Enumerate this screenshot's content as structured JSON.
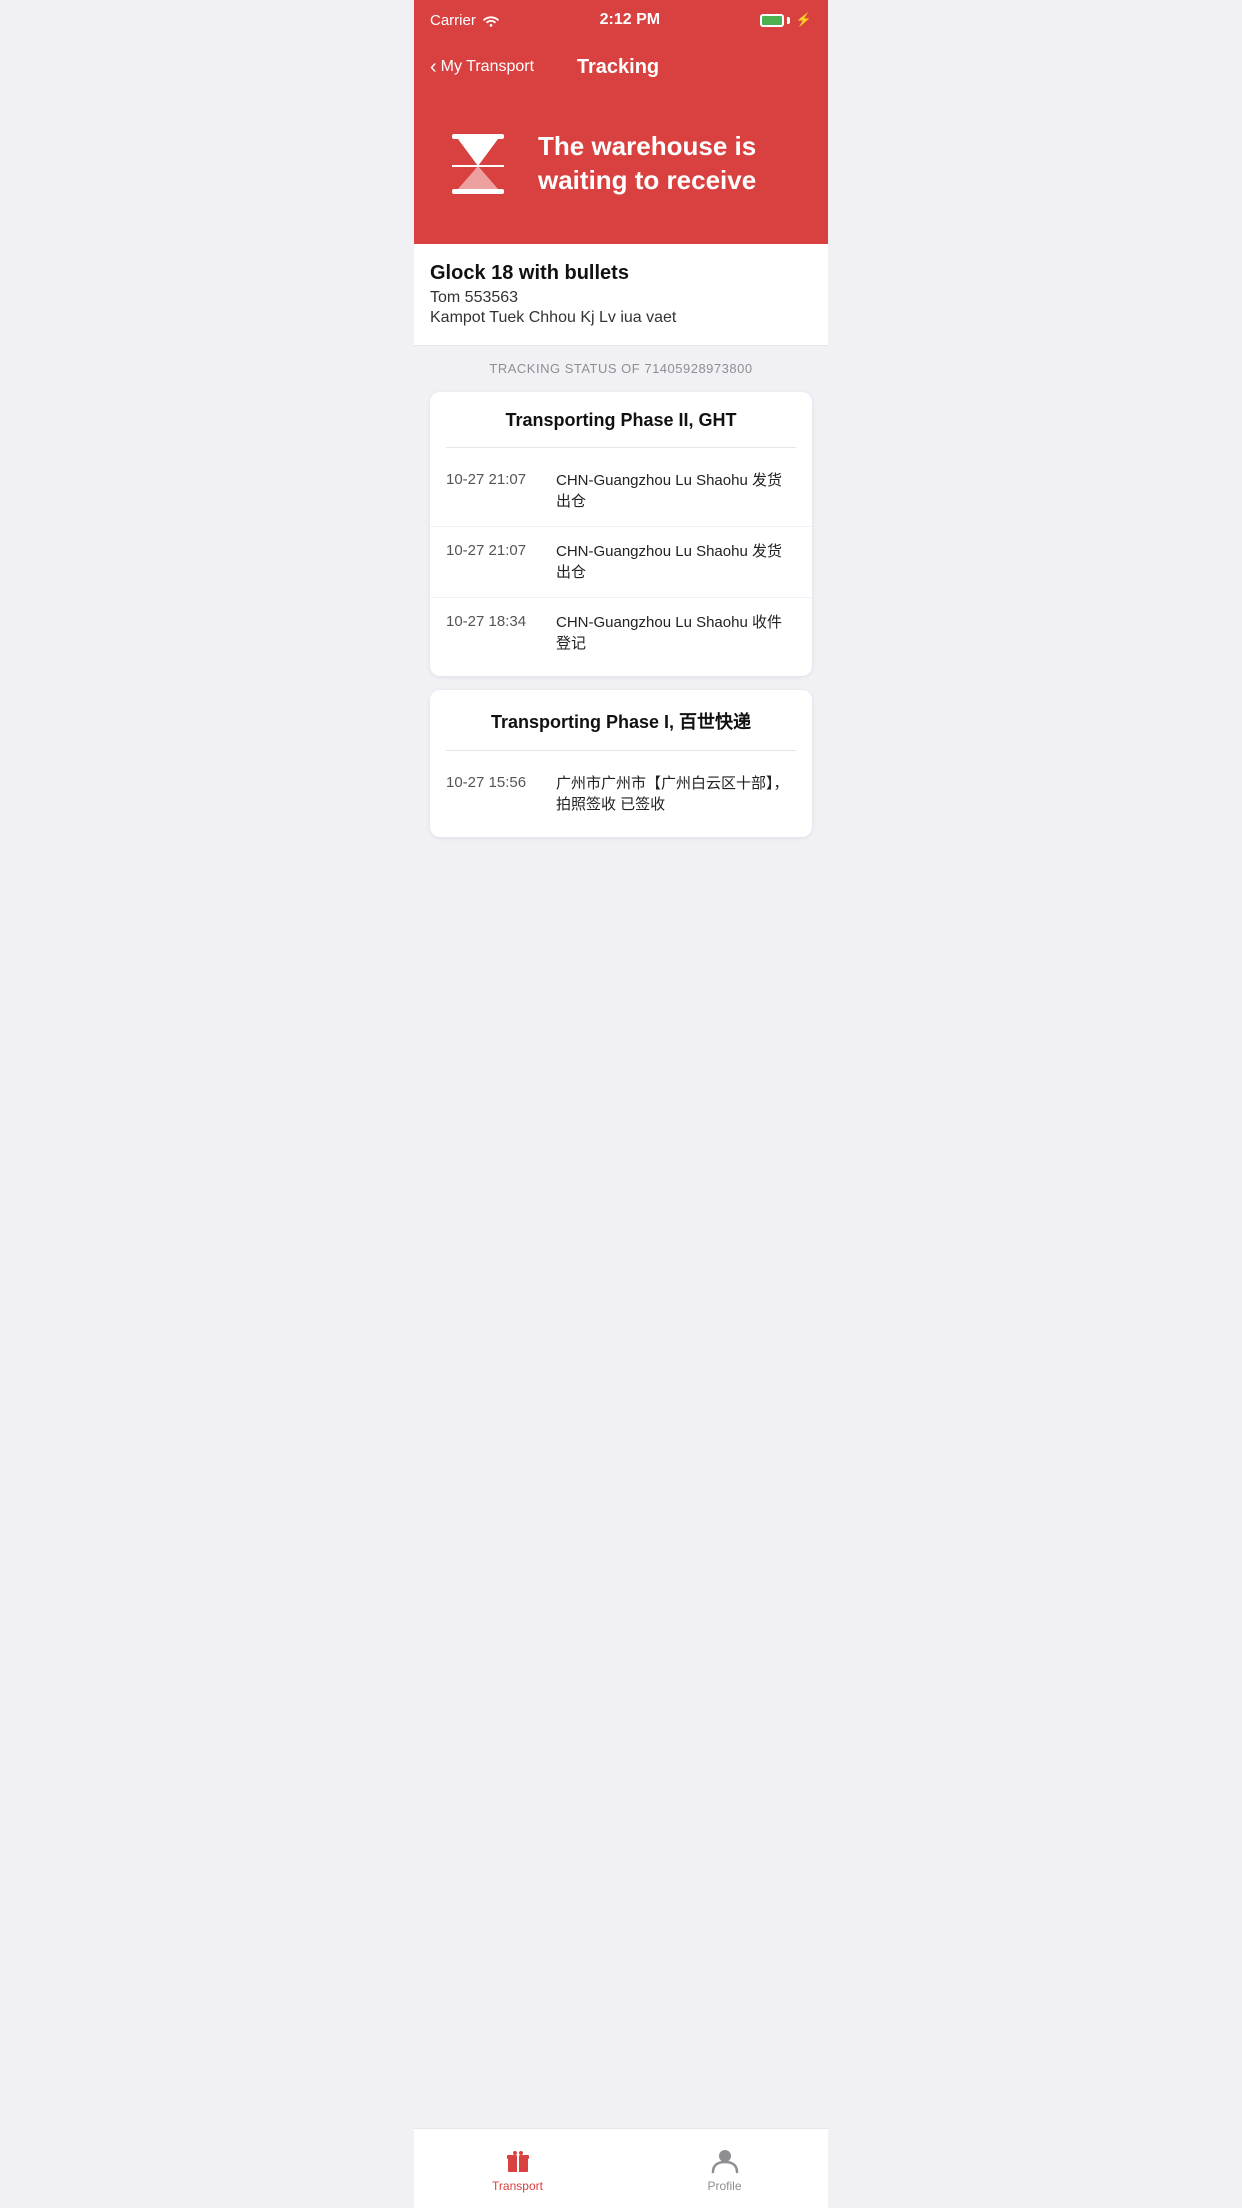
{
  "statusBar": {
    "carrier": "Carrier",
    "time": "2:12 PM"
  },
  "nav": {
    "backLabel": "My Transport",
    "title": "Tracking"
  },
  "hero": {
    "statusText": "The warehouse is waiting to receive"
  },
  "package": {
    "name": "Glock 18 with bullets",
    "recipient": "Tom 553563",
    "address": "Kampot Tuek Chhou Kj Lv iua vaet"
  },
  "trackingStatus": {
    "label": "TRACKING STATUS OF 71405928973800"
  },
  "phases": [
    {
      "title": "Transporting Phase II, GHT",
      "events": [
        {
          "time": "10-27 21:07",
          "description": "CHN-Guangzhou Lu Shaohu 发货出仓"
        },
        {
          "time": "10-27 21:07",
          "description": "CHN-Guangzhou Lu Shaohu 发货出仓"
        },
        {
          "time": "10-27 18:34",
          "description": "CHN-Guangzhou Lu Shaohu 收件登记"
        }
      ]
    },
    {
      "title": "Transporting Phase I, 百世快递",
      "events": [
        {
          "time": "10-27 15:56",
          "description": "广州市广州市【广州白云区十部】，拍照签收 已签收"
        }
      ]
    }
  ],
  "tabs": [
    {
      "label": "Transport",
      "active": true,
      "icon": "gift"
    },
    {
      "label": "Profile",
      "active": false,
      "icon": "person"
    }
  ]
}
